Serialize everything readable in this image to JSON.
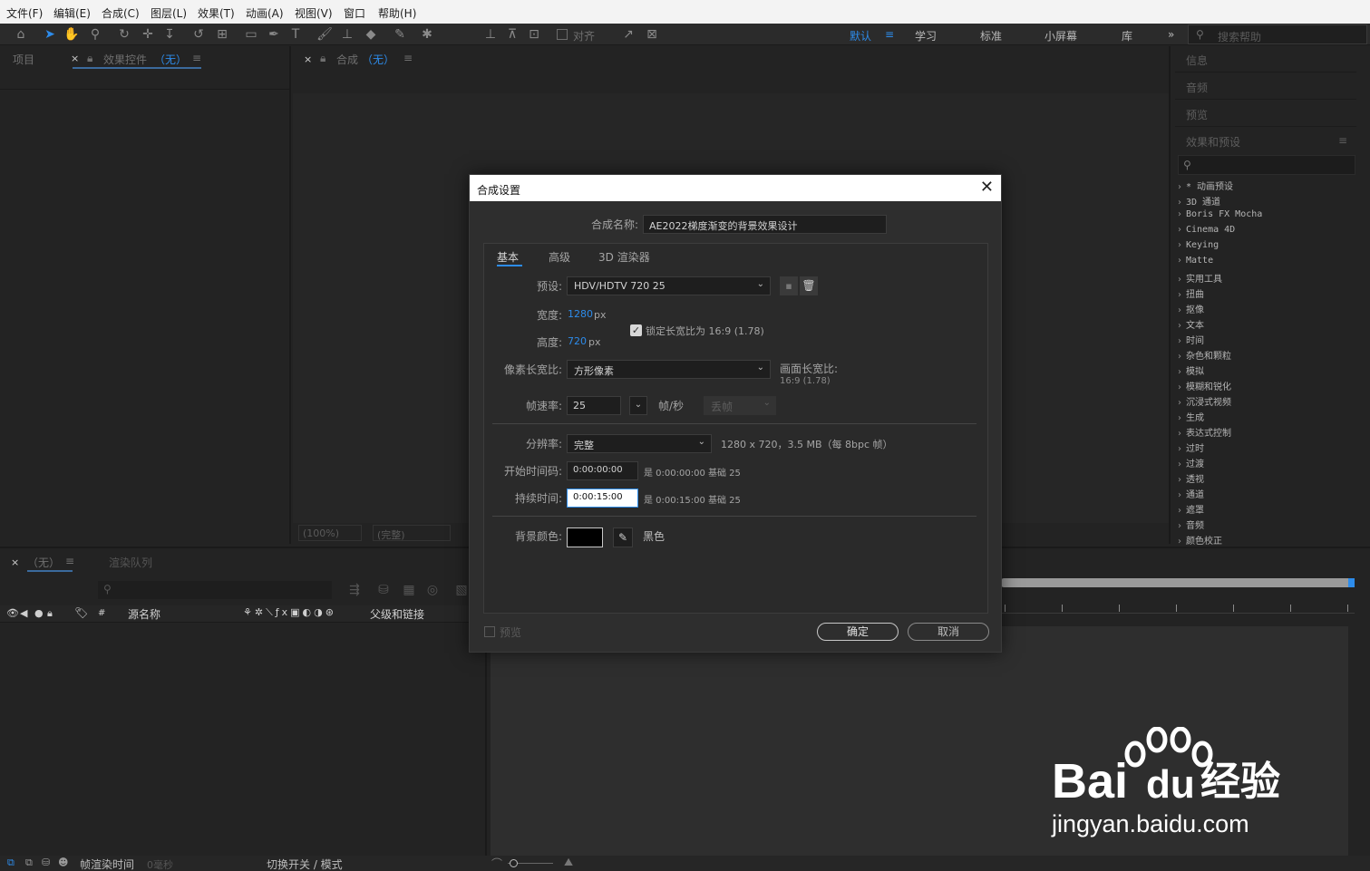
{
  "menu": [
    "文件(F)",
    "编辑(E)",
    "合成(C)",
    "图层(L)",
    "效果(T)",
    "动画(A)",
    "视图(V)",
    "窗口",
    "帮助(H)"
  ],
  "toolbar": {
    "align_label": "对齐",
    "workspaces": [
      "默认",
      "学习",
      "标准",
      "小屏幕",
      "库"
    ],
    "more": "»",
    "search_placeholder": "搜索帮助"
  },
  "left_panel": {
    "tab_project": "项目",
    "tab_effects": "效果控件",
    "tab_effects_suffix": "（无）"
  },
  "comp_panel": {
    "tab_label": "合成",
    "tab_suffix": "（无）",
    "zoom": "(100%)",
    "quality": "(完整)"
  },
  "right_panels": {
    "info": "信息",
    "audio": "音频",
    "preview": "预览",
    "effects_presets": "效果和预设",
    "effects_list": [
      "* 动画预设",
      "3D 通道",
      "Boris FX Mocha",
      "Cinema 4D",
      "Keying",
      "Matte",
      "实用工具",
      "扭曲",
      "抠像",
      "文本",
      "时间",
      "杂色和颗粒",
      "模拟",
      "模糊和锐化",
      "沉浸式视频",
      "生成",
      "表达式控制",
      "过时",
      "过渡",
      "透视",
      "通道",
      "遮罩",
      "音频",
      "颜色校正"
    ]
  },
  "timeline": {
    "tab_label": "（无）",
    "render_queue": "渲染队列",
    "col_source": "源名称",
    "col_hash": "#",
    "col_parent": "父级和链接",
    "footer_render_time": "帧渲染时间",
    "footer_render_value": "0毫秒",
    "footer_toggle": "切换开关 / 模式"
  },
  "dialog": {
    "title": "合成设置",
    "name_label": "合成名称:",
    "name_value": "AE2022梯度渐变的背景效果设计",
    "tabs": [
      "基本",
      "高级",
      "3D 渲染器"
    ],
    "preset_label": "预设:",
    "preset_value": "HDV/HDTV 720 25",
    "width_label": "宽度:",
    "width_value": "1280",
    "height_label": "高度:",
    "height_value": "720",
    "px_unit": "px",
    "lock_label": "锁定长宽比为 16:9 (1.78)",
    "pixel_aspect_label": "像素长宽比:",
    "pixel_aspect_value": "方形像素",
    "frame_aspect_label": "画面长宽比:",
    "frame_aspect_value": "16:9 (1.78)",
    "fps_label": "帧速率:",
    "fps_value": "25",
    "fps_unit": "帧/秒",
    "drop_frame": "丢帧",
    "resolution_label": "分辨率:",
    "resolution_value": "完整",
    "resolution_info": "1280 x 720，3.5 MB（每 8bpc 帧）",
    "start_tc_label": "开始时间码:",
    "start_tc_value": "0:00:00:00",
    "start_tc_info": "是 0:00:00:00  基础 25",
    "duration_label": "持续时间:",
    "duration_value": "0:00:15:00",
    "duration_info": "是 0:00:15:00  基础 25",
    "bg_label": "背景颜色:",
    "bg_color": "#000000",
    "bg_name": "黑色",
    "preview_label": "预览",
    "ok_label": "确定",
    "cancel_label": "取消"
  },
  "watermark": {
    "brand": "Bai",
    "brand2": "du",
    "brand_cn": "经验",
    "url": "jingyan.baidu.com"
  }
}
